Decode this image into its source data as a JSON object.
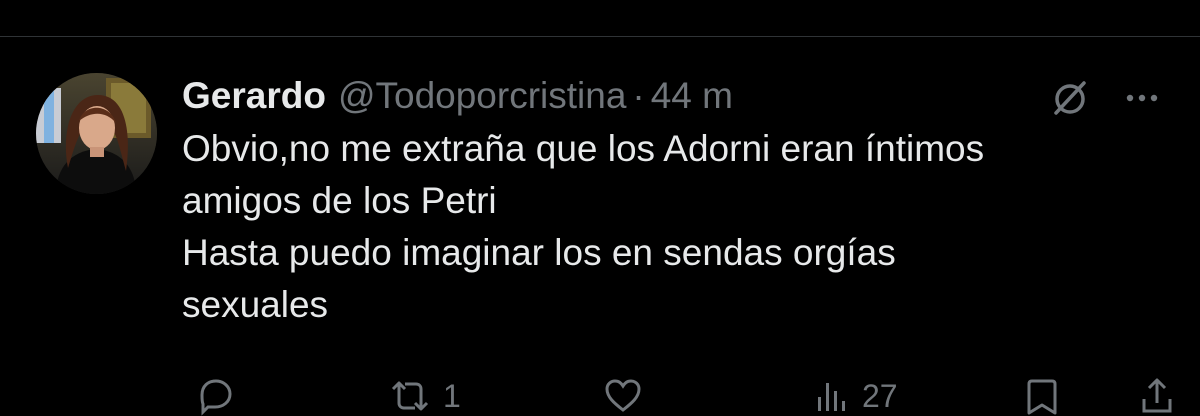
{
  "tweet": {
    "author": {
      "display_name": "Gerardo",
      "handle": "@Todoporcristina",
      "separator": "·",
      "time": "44 m"
    },
    "body_lines": [
      "Obvio,no me extraña que los Adorni eran íntimos",
      "amigos de los Petri",
      "Hasta puedo imaginar los en sendas orgías",
      "sexuales"
    ],
    "icons": {
      "grok": "grok-icon",
      "more": "more-icon",
      "reply": "reply-icon",
      "retweet": "retweet-icon",
      "like": "like-icon",
      "views": "views-icon",
      "bookmark": "bookmark-icon",
      "share": "share-icon"
    },
    "stats": {
      "retweets": "1",
      "views": "27"
    }
  },
  "colors": {
    "background": "#000000",
    "primary_text": "#e7e9ea",
    "secondary_text": "#71767b",
    "divider": "#2f3336"
  }
}
